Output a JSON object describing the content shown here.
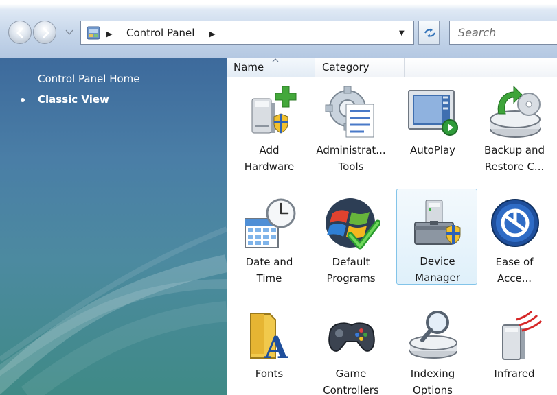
{
  "address": {
    "breadcrumb": "Control Panel",
    "search_placeholder": "Search"
  },
  "sidebar": {
    "home_link": "Control Panel Home",
    "classic_view": "Classic View"
  },
  "columns": {
    "name": "Name",
    "category": "Category"
  },
  "items": [
    {
      "label": "Add\nHardware",
      "icon": "add-hardware-icon"
    },
    {
      "label": "Administrat...\nTools",
      "icon": "administrative-tools-icon"
    },
    {
      "label": "AutoPlay",
      "icon": "autoplay-icon"
    },
    {
      "label": "Backup and\nRestore C...",
      "icon": "backup-restore-icon"
    },
    {
      "label": "Date and\nTime",
      "icon": "date-time-icon"
    },
    {
      "label": "Default\nPrograms",
      "icon": "default-programs-icon"
    },
    {
      "label": "Device\nManager",
      "icon": "device-manager-icon",
      "selected": true
    },
    {
      "label": "Ease of\nAcce...",
      "icon": "ease-of-access-icon"
    },
    {
      "label": "Fonts",
      "icon": "fonts-icon"
    },
    {
      "label": "Game\nControllers",
      "icon": "game-controllers-icon"
    },
    {
      "label": "Indexing\nOptions",
      "icon": "indexing-options-icon"
    },
    {
      "label": "Infrared",
      "icon": "infrared-icon"
    }
  ],
  "colors": {
    "sidebar_top": "#3d6a9c",
    "sidebar_bottom": "#3f8a86",
    "selection_border": "#83c4e9",
    "selection_fill": "#dff0fa"
  }
}
